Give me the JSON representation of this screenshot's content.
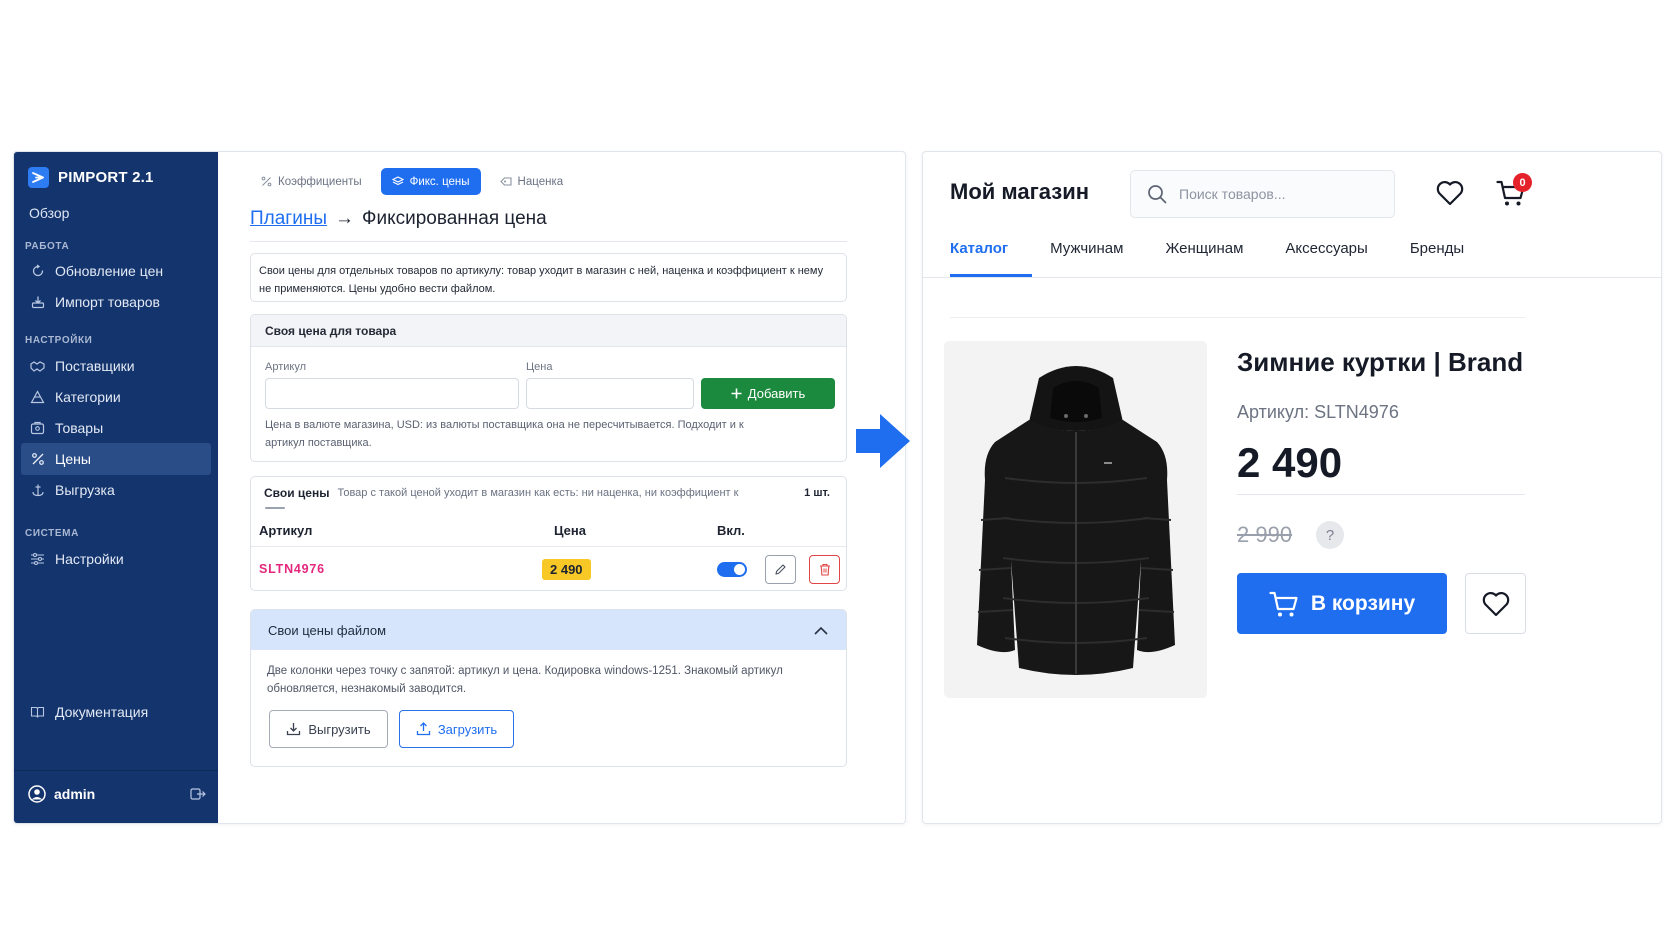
{
  "admin": {
    "brand": "PIMPORT 2.1",
    "overview": "Обзор",
    "sections": {
      "work": "РАБОТА",
      "settings": "НАСТРОЙКИ",
      "system": "СИСТЕМА"
    },
    "nav": {
      "update_prices": "Обновление цен",
      "import_products": "Импорт товаров",
      "suppliers": "Поставщики",
      "categories": "Категории",
      "products": "Товары",
      "prices": "Цены",
      "export": "Выгрузка",
      "settings": "Настройки",
      "docs": "Документация"
    },
    "active_nav": "prices",
    "user": "admin",
    "tabs": {
      "coefficients": "Коэффициенты",
      "fixed": "Фикс. цены",
      "markup": "Наценка"
    },
    "breadcrumb": {
      "link": "Плагины",
      "arrow": "→",
      "title": "Фиксированная цена"
    },
    "info_text": "Свои цены для отдельных товаров по артикулу: товар уходит в магазин с ней, наценка и коэффициент к нему не применяются. Цены удобно вести файлом.",
    "own_price": {
      "heading": "Своя цена для товара",
      "sku_label": "Артикул",
      "price_label": "Цена",
      "sku_value": "",
      "price_value": "",
      "add_button": "Добавить",
      "help": "Цена в валюте магазина, USD: из валюты поставщика она не пересчитывается. Подходит и к артикул поставщика."
    },
    "list": {
      "title": "Свои цены",
      "subtitle": "Товар с такой ценой уходит в магазин как есть: ни наценка, ни коэффициент к",
      "count": "1 шт.",
      "columns": {
        "sku": "Артикул",
        "price": "Цена",
        "enabled": "Вкл."
      },
      "rows": [
        {
          "sku": "SLTN4976",
          "price": "2 490",
          "enabled": true
        }
      ]
    },
    "file": {
      "heading": "Свои цены файлом",
      "text": "Две колонки через точку с запятой: артикул и цена. Кодировка windows-1251. Знакомый артикул обновляется, незнакомый заводится.",
      "export_button": "Выгрузить",
      "import_button": "Загрузить"
    }
  },
  "shop": {
    "name": "Мой магазин",
    "search_placeholder": "Поиск товаров...",
    "cart_count": "0",
    "nav": [
      "Каталог",
      "Мужчинам",
      "Женщинам",
      "Аксессуары",
      "Бренды"
    ],
    "active_nav": "Каталог",
    "product": {
      "title": "Зимние куртки | Brand",
      "sku": "Артикул: SLTN4976",
      "price": "2 490",
      "old_price": "2 990",
      "help_mark": "?",
      "buy_button": "В корзину"
    }
  },
  "colors": {
    "sidebar": "#13346c",
    "accent_blue": "#1f6ef0",
    "add_green": "#1c8a3e",
    "sku_pink": "#e4267d",
    "price_badge": "#f7c826",
    "cart_badge": "#e5222a"
  }
}
